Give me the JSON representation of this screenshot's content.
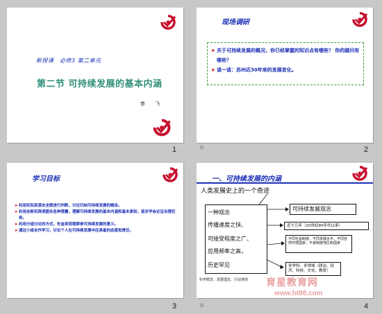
{
  "slides": [
    {
      "number": "1",
      "subtitle": "新授课　必修3 第二单元",
      "title": "第二节 可持续发展的基本内涵",
      "author": "参 飞"
    },
    {
      "number": "2",
      "title": "现场调研",
      "bullets": [
        "关于可持续发展的概况，你已经掌握的知识点有哪些？ 你的疑问有哪些？",
        "谈一谈：苏州近30年来的发展变化。"
      ]
    },
    {
      "number": "3",
      "title": "学习目标",
      "bullets": [
        "利用实际资源去全貌进行判断，讨论归纳可持续发展的概念。",
        "利用全新实践读图去各种理量，理解可持续发展的基本内涵和基本原则，逐步学会论证合理任务。",
        "利用分组讨论的方式，失金到现程群参可持续发展的意义。",
        "通过小组合作学习，讨论个人在可持续发展中应具备的态度和责任。"
      ]
    },
    {
      "number": "4",
      "header": "一、可持续发展的内涵",
      "caption": "人类发展史上的一个奇迹",
      "left_lines": [
        "一种观念",
        "传播速度之快、",
        "可接受程度之广、",
        "应用频率之高，",
        "历史罕见"
      ],
      "box_concept": "可持续发展观念",
      "box_time": "近十几年（20世纪80年代以来）",
      "box_range": "不同社会制度、不同发展水平、不同自然环境国家，不受制度地区和国家",
      "box_fields": "多学科、多领域（政治、经济、科技、文化、教育）",
      "footnote": "科学概念、发展理念、行动准则",
      "watermark_cn": "育星教育网",
      "watermark_url": "www.ht88.com"
    }
  ],
  "notes_icon": "notes-icon",
  "colors": {
    "title_blue": "#1a2fb5",
    "green": "#2f8f7a",
    "bullet_red": "#d20000",
    "logo_red": "#c8102e"
  }
}
